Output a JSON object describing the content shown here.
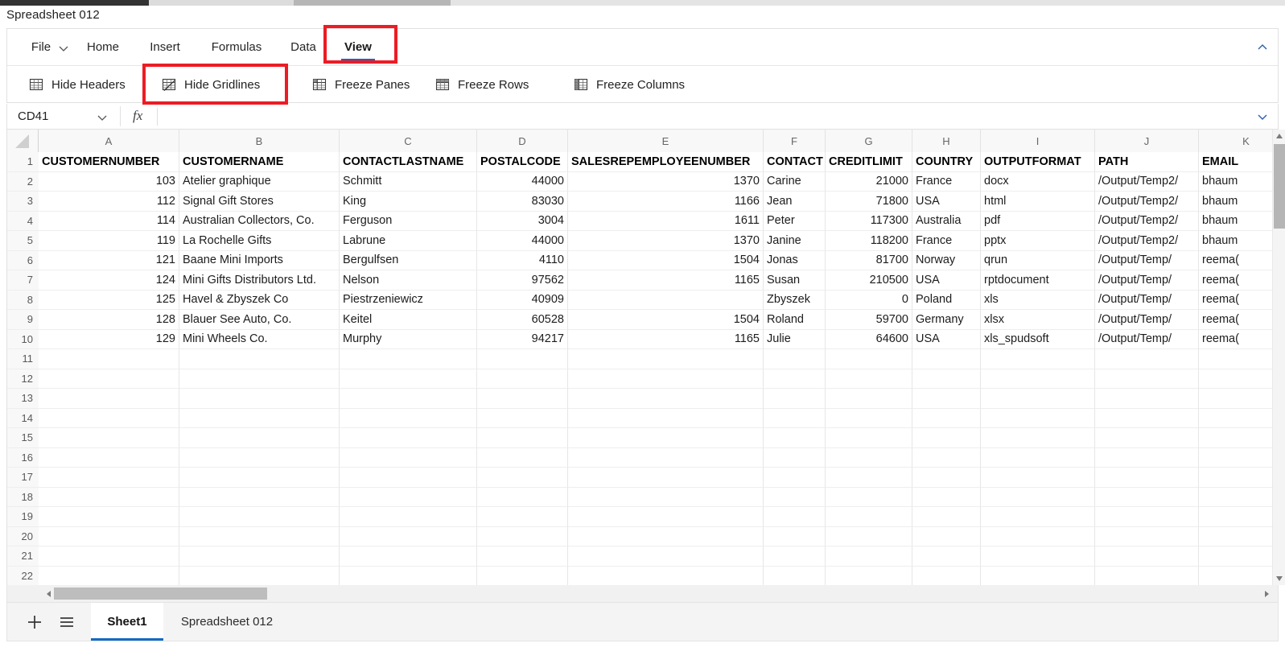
{
  "window": {
    "doc_title": "Spreadsheet 012"
  },
  "ribbon": {
    "tabs": [
      {
        "label": "File",
        "active": false
      },
      {
        "label": "Home",
        "active": false
      },
      {
        "label": "Insert",
        "active": false
      },
      {
        "label": "Formulas",
        "active": false
      },
      {
        "label": "Data",
        "active": false
      },
      {
        "label": "View",
        "active": true
      }
    ],
    "file_chevron_icon": "chevron-down-icon",
    "collapse_icon": "chevron-up-icon",
    "commands": [
      {
        "label": "Hide Headers",
        "icon": "table-grid-icon"
      },
      {
        "label": "Hide Gridlines",
        "icon": "table-no-gridlines-icon"
      },
      {
        "label": "Freeze Panes",
        "icon": "freeze-panes-icon"
      },
      {
        "label": "Freeze Rows",
        "icon": "freeze-rows-icon"
      },
      {
        "label": "Freeze Columns",
        "icon": "freeze-columns-icon"
      }
    ]
  },
  "formula_bar": {
    "name_box_value": "CD41",
    "name_box_chevron_icon": "chevron-down-icon",
    "fx_label": "fx",
    "formula_value": "",
    "expand_icon": "chevron-down-icon"
  },
  "annotations": {
    "accent_color": "#ec1c24",
    "boxes": [
      {
        "target": "View tab"
      },
      {
        "target": "Hide Gridlines button"
      }
    ]
  },
  "grid": {
    "column_letters": [
      "A",
      "B",
      "C",
      "D",
      "E",
      "F",
      "G",
      "H",
      "I",
      "J",
      "K"
    ],
    "row_numbers": [
      1,
      2,
      3,
      4,
      5,
      6,
      7,
      8,
      9,
      10,
      11,
      12,
      13,
      14,
      15,
      16,
      17,
      18,
      19,
      20,
      21,
      22
    ],
    "header_row": [
      "CUSTOMERNUMBER",
      "CUSTOMERNAME",
      "CONTACTLASTNAME",
      "POSTALCODE",
      "SALESREPEMPLOYEENUMBER",
      "CONTACT",
      "CREDITLIMIT",
      "COUNTRY",
      "OUTPUTFORMAT",
      "PATH",
      "EMAIL"
    ],
    "rows": [
      [
        "103",
        "Atelier graphique",
        "Schmitt",
        "44000",
        "1370",
        "Carine",
        "21000",
        "France",
        "docx",
        "/Output/Temp2/",
        "bhaum"
      ],
      [
        "112",
        "Signal Gift Stores",
        "King",
        "83030",
        "1166",
        "Jean",
        "71800",
        "USA",
        "html",
        "/Output/Temp2/",
        "bhaum"
      ],
      [
        "114",
        "Australian Collectors, Co.",
        "Ferguson",
        "3004",
        "1611",
        "Peter",
        "117300",
        "Australia",
        "pdf",
        "/Output/Temp2/",
        "bhaum"
      ],
      [
        "119",
        "La Rochelle Gifts",
        "Labrune",
        "44000",
        "1370",
        "Janine",
        "118200",
        "France",
        "pptx",
        "/Output/Temp2/",
        "bhaum"
      ],
      [
        "121",
        "Baane Mini Imports",
        "Bergulfsen",
        "4110",
        "1504",
        "Jonas",
        "81700",
        "Norway",
        "qrun",
        "/Output/Temp/",
        "reema("
      ],
      [
        "124",
        "Mini Gifts Distributors Ltd.",
        "Nelson",
        "97562",
        "1165",
        "Susan",
        "210500",
        "USA",
        "rptdocument",
        "/Output/Temp/",
        "reema("
      ],
      [
        "125",
        "Havel & Zbyszek Co",
        "Piestrzeniewicz",
        "40909",
        "",
        "Zbyszek",
        "0",
        "Poland",
        "xls",
        "/Output/Temp/",
        "reema("
      ],
      [
        "128",
        "Blauer See Auto, Co.",
        "Keitel",
        "60528",
        "1504",
        "Roland",
        "59700",
        "Germany",
        "xlsx",
        "/Output/Temp/",
        "reema("
      ],
      [
        "129",
        "Mini Wheels Co.",
        "Murphy",
        "94217",
        "1165",
        "Julie",
        "64600",
        "USA",
        "xls_spudsoft",
        "/Output/Temp/",
        "reema("
      ]
    ],
    "numeric_columns": [
      0,
      3,
      4,
      6
    ]
  },
  "scrollbars": {
    "vertical_up_icon": "triangle-up-icon",
    "vertical_down_icon": "triangle-down-icon",
    "horizontal_left_icon": "triangle-left-icon",
    "horizontal_right_icon": "triangle-right-icon"
  },
  "sheet_bar": {
    "add_icon": "plus-icon",
    "menu_icon": "hamburger-icon",
    "tabs": [
      {
        "label": "Sheet1",
        "active": true
      },
      {
        "label": "Spreadsheet 012",
        "active": false
      }
    ]
  }
}
